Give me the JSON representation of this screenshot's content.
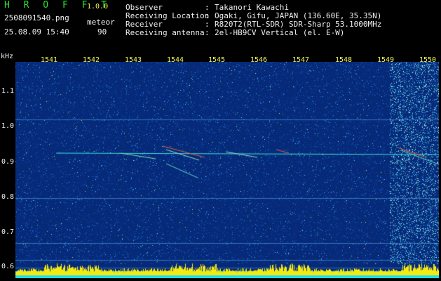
{
  "app": {
    "brand": "H R O F F T",
    "version": "1.0.0",
    "filename": "2508091540.png",
    "mode": "meteor",
    "datetime": "25.08.09 15:40",
    "count": "90"
  },
  "meta": [
    {
      "key": "Observer",
      "value": "Takanori Kawachi"
    },
    {
      "key": "Receiving Location",
      "value": "Ogaki, Gifu, JAPAN (136.60E, 35.35N)"
    },
    {
      "key": "Receiver",
      "value": "R820T2(RTL-SDR) SDR-Sharp 53.1000MHz"
    },
    {
      "key": "Receiving antenna",
      "value": "2el-HB9CV Vertical (el. E-W)"
    }
  ],
  "separator": ":",
  "axis": {
    "unit": "kHz",
    "x_ticks": [
      "1541",
      "1542",
      "1543",
      "1544",
      "1545",
      "1546",
      "1547",
      "1548",
      "1549",
      "1550"
    ],
    "y_ticks": [
      "1.1",
      "1.0",
      "0.9",
      "0.8",
      "0.7",
      "0.6"
    ]
  },
  "colors": {
    "background": "#000000",
    "plot_background": "#062a78",
    "header_green": "#27e62b",
    "header_yellow": "#f2f25a",
    "trace_cyan": "#3ee0d8",
    "echo_red": "#e85a40",
    "spectrum_yellow": "#f5ea10"
  }
}
